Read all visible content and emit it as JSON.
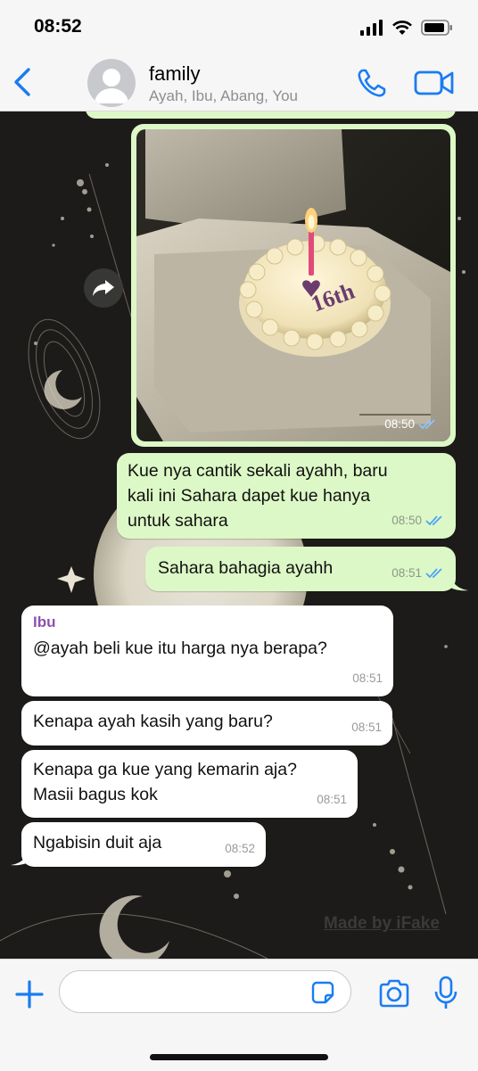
{
  "status": {
    "time": "08:52"
  },
  "header": {
    "title": "family",
    "subtitle": "Ayah, Ibu, Abang, You",
    "icons": {
      "back": "chevron-left-icon",
      "avatar": "person-icon",
      "call": "phone-icon",
      "video": "video-camera-icon"
    },
    "accent": "#1a7cf2"
  },
  "messages": [
    {
      "id": "photo",
      "type": "image",
      "direction": "out",
      "caption": "birthday cake with candle, 16th",
      "time": "08:50",
      "status": "read"
    },
    {
      "id": "m1",
      "direction": "out",
      "text_lines": [
        "Kue nya cantik sekali ayahh, baru",
        "kali ini Sahara dapet kue hanya",
        "untuk sahara"
      ],
      "time": "08:50",
      "status": "read"
    },
    {
      "id": "m2",
      "direction": "out",
      "text": "Sahara bahagia ayahh",
      "time": "08:51",
      "status": "read"
    },
    {
      "id": "m3",
      "direction": "in",
      "sender": "Ibu",
      "text": "@ayah beli kue itu harga nya berapa?",
      "time": "08:51"
    },
    {
      "id": "m4",
      "direction": "in",
      "text": "Kenapa ayah kasih yang baru?",
      "time": "08:51"
    },
    {
      "id": "m5",
      "direction": "in",
      "text_lines": [
        "Kenapa ga kue yang kemarin aja?",
        "Masii bagus kok"
      ],
      "time": "08:51"
    },
    {
      "id": "m6",
      "direction": "in",
      "text": "Ngabisin duit aja",
      "time": "08:52"
    }
  ],
  "photo_text": "16th",
  "watermark": "Made by iFake",
  "colors": {
    "outgoing_bubble": "#dcf8c6",
    "incoming_bubble": "#ffffff",
    "read_ticks": "#4fa3f7",
    "sender_name": "#8a52b0"
  },
  "composer": {
    "placeholder": "",
    "icons": [
      "plus-icon",
      "sticker-icon",
      "camera-icon",
      "microphone-icon"
    ]
  }
}
